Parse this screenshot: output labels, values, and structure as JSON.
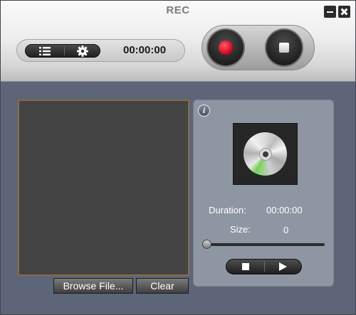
{
  "window": {
    "title": "REC",
    "minimize_icon": "minimize-icon",
    "close_icon": "close-icon"
  },
  "toolbar": {
    "list_icon": "list-icon",
    "settings_icon": "gear-icon",
    "timer": "00:00:00",
    "record_icon": "record-icon",
    "stop_icon": "stop-icon",
    "record_color": "#e0001f"
  },
  "preview": {
    "border_color": "#8c6a46",
    "browse_label": "Browse File...",
    "clear_label": "Clear"
  },
  "info": {
    "info_icon_label": "i",
    "disc_icon": "cd-icon",
    "duration_label": "Duration:",
    "duration_value": "00:00:00",
    "size_label": "Size:",
    "size_value": "0",
    "playback_progress": 0,
    "stop_icon": "stop-icon",
    "play_icon": "play-icon"
  }
}
